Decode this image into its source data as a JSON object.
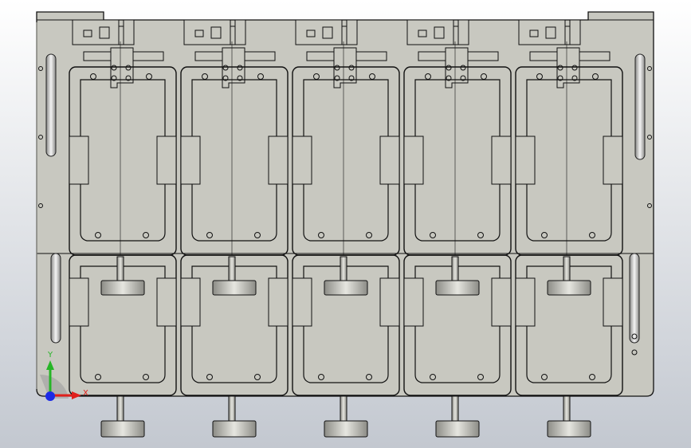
{
  "viewport": {
    "background_top": "#ffffff",
    "background_bottom": "#c3c8d0"
  },
  "model": {
    "body_fill": "#c8c8c0",
    "panel_fill": "#c9c9c1",
    "edge_color": "#111111",
    "shadow_color": "#8f9088",
    "slot_fill": "#e9e9e9",
    "station_count": 5
  },
  "triad": {
    "x_label": "X",
    "y_label": "Y",
    "x_color": "#e0201c",
    "y_color": "#26b526",
    "z_color": "#1c2be6"
  }
}
